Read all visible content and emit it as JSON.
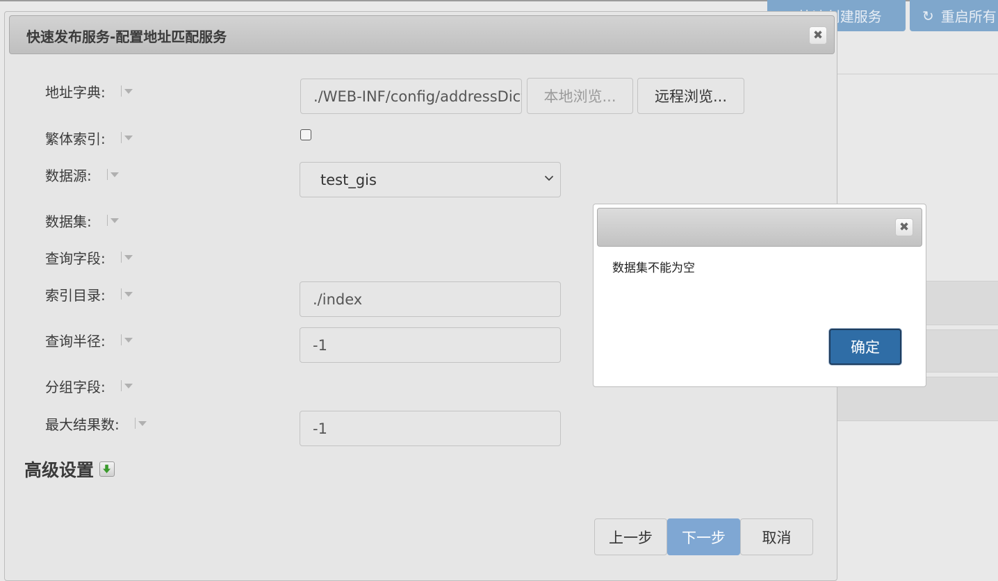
{
  "background": {
    "quick_create_label": "快速创建服务",
    "restart_label": "重启所有"
  },
  "dialog": {
    "title": "快速发布服务-配置地址匹配服务",
    "fields": {
      "address_dict": {
        "label": "地址字典:",
        "value": "./WEB-INF/config/addressDict",
        "local_browse": "本地浏览...",
        "remote_browse": "远程浏览..."
      },
      "traditional_index": {
        "label": "繁体索引:",
        "checked": false
      },
      "datasource": {
        "label": "数据源:",
        "value": "test_gis"
      },
      "dataset": {
        "label": "数据集:"
      },
      "query_field": {
        "label": "查询字段:"
      },
      "index_dir": {
        "label": "索引目录:",
        "value": "./index"
      },
      "query_radius": {
        "label": "查询半径:",
        "value": "-1"
      },
      "group_field": {
        "label": "分组字段:"
      },
      "max_results": {
        "label": "最大结果数:",
        "value": "-1"
      }
    },
    "advanced_label": "高级设置",
    "buttons": {
      "prev": "上一步",
      "next": "下一步",
      "cancel": "取消"
    }
  },
  "alert": {
    "message": "数据集不能为空",
    "ok_label": "确定"
  }
}
